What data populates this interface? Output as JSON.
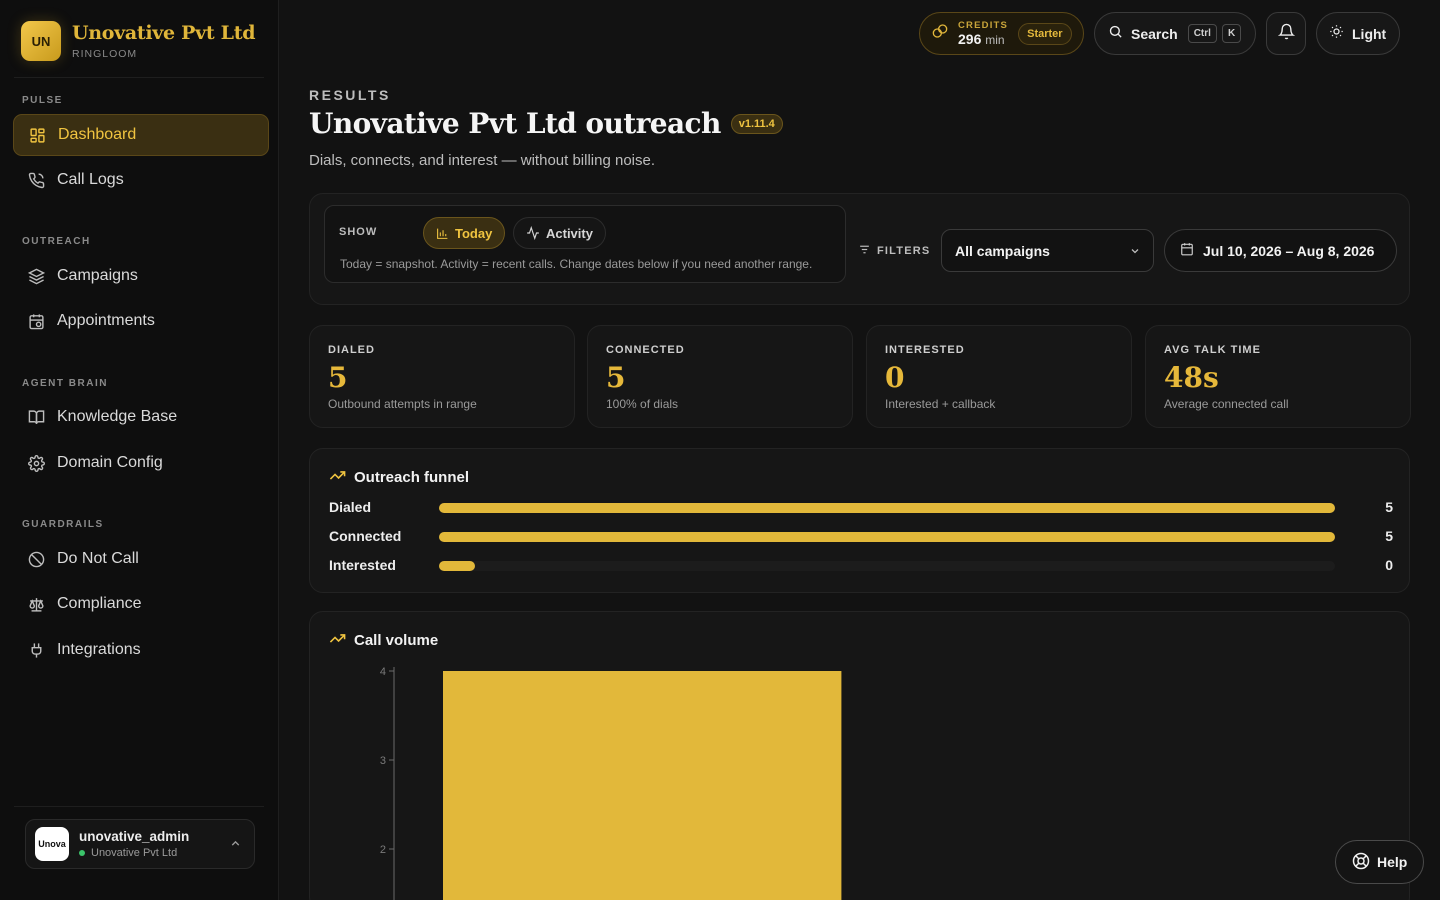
{
  "brand": {
    "logo_text": "UN",
    "name": "Unovative Pvt Ltd",
    "sub": "RINGLOOM"
  },
  "sidebar": {
    "sections": [
      {
        "title": "PULSE",
        "items": [
          {
            "label": "Dashboard",
            "icon": "grid-icon",
            "active": true
          },
          {
            "label": "Call Logs",
            "icon": "phone-icon"
          }
        ]
      },
      {
        "title": "OUTREACH",
        "items": [
          {
            "label": "Campaigns",
            "icon": "layers-icon"
          },
          {
            "label": "Appointments",
            "icon": "calendar-icon"
          }
        ]
      },
      {
        "title": "AGENT BRAIN",
        "items": [
          {
            "label": "Knowledge Base",
            "icon": "book-icon"
          },
          {
            "label": "Domain Config",
            "icon": "gear-icon"
          }
        ]
      },
      {
        "title": "GUARDRAILS",
        "items": [
          {
            "label": "Do Not Call",
            "icon": "ban-icon"
          },
          {
            "label": "Compliance",
            "icon": "scale-icon"
          },
          {
            "label": "Integrations",
            "icon": "plug-icon"
          }
        ]
      }
    ],
    "user": {
      "avatar_text": "Unova",
      "name": "unovative_admin",
      "org": "Unovative Pvt Ltd"
    }
  },
  "topbar": {
    "credits_label": "CREDITS",
    "credits_value": "296",
    "credits_unit": "min",
    "plan": "Starter",
    "search_label": "Search",
    "kbd_1": "Ctrl",
    "kbd_2": "K",
    "theme_label": "Light"
  },
  "header": {
    "eyebrow": "RESULTS",
    "title": "Unovative Pvt Ltd outreach",
    "version": "v1.11.4",
    "subtitle": "Dials, connects, and interest — without billing noise."
  },
  "controls": {
    "show_label": "SHOW",
    "today_label": "Today",
    "activity_label": "Activity",
    "hint": "Today = snapshot. Activity = recent calls. Change dates below if you need another range.",
    "filters_label": "FILTERS",
    "campaign_value": "All campaigns",
    "date_range": "Jul 10, 2026 – Aug 8, 2026"
  },
  "stats": [
    {
      "label": "DIALED",
      "value": "5",
      "note": "Outbound attempts in range"
    },
    {
      "label": "CONNECTED",
      "value": "5",
      "note": "100% of dials"
    },
    {
      "label": "INTERESTED",
      "value": "0",
      "note": "Interested + callback"
    },
    {
      "label": "AVG TALK TIME",
      "value": "48s",
      "note": "Average connected call"
    }
  ],
  "funnel": {
    "title": "Outreach funnel",
    "rows": [
      {
        "label": "Dialed",
        "value": "5",
        "fill_fraction": 1.0
      },
      {
        "label": "Connected",
        "value": "5",
        "fill_fraction": 1.0
      },
      {
        "label": "Interested",
        "value": "0",
        "fill_fraction": 0.04
      }
    ]
  },
  "colors": {
    "accent": "#E2B83A",
    "background": "#121212",
    "sidebar": "#0E0E0E"
  },
  "help_label": "Help",
  "chart_data": {
    "type": "bar",
    "title": "Call volume",
    "categories": [
      ""
    ],
    "series": [
      {
        "values": [
          4
        ]
      }
    ],
    "y_ticks": [
      "2",
      "3",
      "4"
    ],
    "ylim": [
      0,
      4
    ],
    "grid": false
  }
}
